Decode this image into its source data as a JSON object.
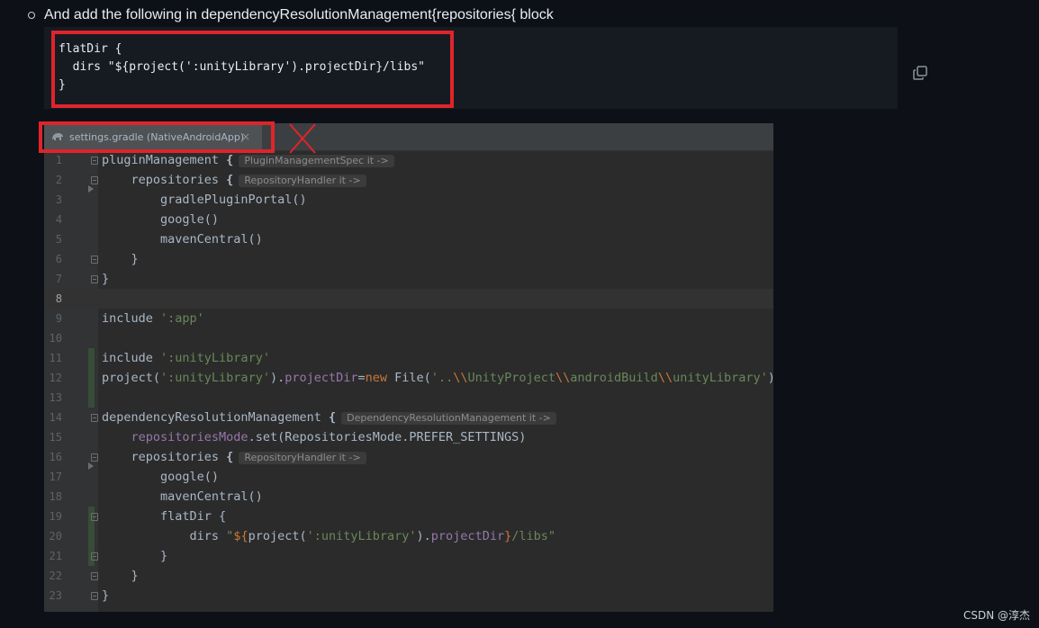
{
  "intro_text": "And add the following in dependencyResolutionManagement{repositories{ block",
  "snippet": {
    "lines": [
      "flatDir {",
      "  dirs \"${project(':unityLibrary').projectDir}/libs\"",
      "}"
    ]
  },
  "editor": {
    "tab_label": "settings.gradle (NativeAndroidApp)",
    "tab_close": "×",
    "current_line": 8,
    "line_numbers": [
      "1",
      "2",
      "3",
      "4",
      "5",
      "6",
      "7",
      "8",
      "9",
      "10",
      "11",
      "12",
      "13",
      "14",
      "15",
      "16",
      "17",
      "18",
      "19",
      "20",
      "21",
      "22",
      "23"
    ],
    "hints": {
      "plugin_spec": "PluginManagementSpec it ->",
      "repo_handler": "RepositoryHandler it ->",
      "dep_res": "DependencyResolutionManagement it ->"
    }
  },
  "watermark": "CSDN @淳杰",
  "colors": {
    "accent_red": "#e0242b",
    "editor_bg": "#2b2b2b",
    "page_bg": "#0d1117"
  },
  "icons": [
    "copy-icon",
    "gradle-elephant-icon",
    "close-icon",
    "fold-icon",
    "expand-arrow-icon",
    "red-x-mark"
  ]
}
